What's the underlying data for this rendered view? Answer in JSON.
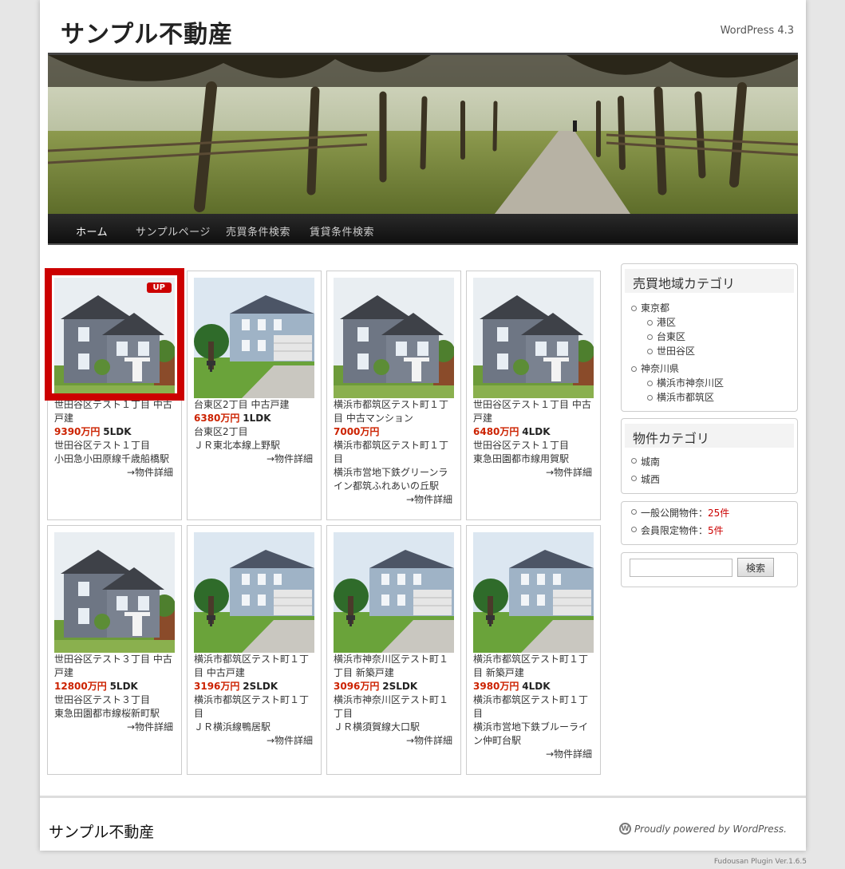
{
  "site": {
    "title": "サンプル不動産",
    "description": "WordPress 4.3"
  },
  "nav": {
    "items": [
      "ホーム",
      "サンプルページ",
      "売買条件検索",
      "賃貸条件検索"
    ]
  },
  "properties": [
    {
      "title": "世田谷区テスト１丁目 中古戸建",
      "price": "9390万円",
      "madori": "5LDK",
      "address": "世田谷区テスト１丁目",
      "station": "小田急小田原線千歳船橋駅",
      "detail": "→物件詳細",
      "badge": "UP",
      "image": "house-gray-icon"
    },
    {
      "title": "台東区2丁目 中古戸建",
      "price": "6380万円",
      "madori": "1LDK",
      "address": "台東区2丁目",
      "station": "ＪＲ東北本線上野駅",
      "detail": "→物件詳細",
      "image": "house-blue-icon"
    },
    {
      "title": "横浜市都筑区テスト町１丁目 中古マンション",
      "price": "7000万円",
      "madori": "",
      "address": "横浜市都筑区テスト町１丁目",
      "station": "横浜市営地下鉄グリーンライン都筑ふれあいの丘駅",
      "detail": "→物件詳細",
      "image": "house-gray-icon"
    },
    {
      "title": "世田谷区テスト１丁目 中古戸建",
      "price": "6480万円",
      "madori": "4LDK",
      "address": "世田谷区テスト１丁目",
      "station": "東急田園都市線用賀駅",
      "detail": "→物件詳細",
      "image": "house-gray-icon"
    },
    {
      "title": "世田谷区テスト３丁目 中古戸建",
      "price": "12800万円",
      "madori": "5LDK",
      "address": "世田谷区テスト３丁目",
      "station": "東急田園都市線桜新町駅",
      "detail": "→物件詳細",
      "image": "house-gray-icon"
    },
    {
      "title": "横浜市都筑区テスト町１丁目 中古戸建",
      "price": "3196万円",
      "madori": "2SLDK",
      "address": "横浜市都筑区テスト町１丁目",
      "station": "ＪＲ横浜線鴨居駅",
      "detail": "→物件詳細",
      "image": "house-blue-icon"
    },
    {
      "title": "横浜市神奈川区テスト町１丁目 新築戸建",
      "price": "3096万円",
      "madori": "2SLDK",
      "address": "横浜市神奈川区テスト町１丁目",
      "station": "ＪＲ横須賀線大口駅",
      "detail": "→物件詳細",
      "image": "house-blue-icon"
    },
    {
      "title": "横浜市都筑区テスト町１丁目 新築戸建",
      "price": "3980万円",
      "madori": "4LDK",
      "address": "横浜市都筑区テスト町１丁目",
      "station": "横浜市営地下鉄ブルーライン仲町台駅",
      "detail": "→物件詳細",
      "image": "house-blue-icon"
    }
  ],
  "sidebar": {
    "area_widget": {
      "title": "売買地域カテゴリ",
      "prefectures": [
        {
          "name": "東京都",
          "cities": [
            "港区",
            "台東区",
            "世田谷区"
          ]
        },
        {
          "name": "神奈川県",
          "cities": [
            "横浜市神奈川区",
            "横浜市都筑区"
          ]
        }
      ]
    },
    "category_widget": {
      "title": "物件カテゴリ",
      "items": [
        "城南",
        "城西"
      ]
    },
    "count_widget": {
      "public_label": "一般公開物件：",
      "public_count": "25件",
      "member_label": "会員限定物件：",
      "member_count": "5件"
    },
    "search_widget": {
      "value": "",
      "button_label": "検索"
    }
  },
  "footer": {
    "title": "サンプル不動産",
    "powered": "Proudly powered by WordPress.",
    "plugin_version": "Fudousan Plugin Ver.1.6.5"
  },
  "colors": {
    "price": "#cc2200",
    "highlight": "#cc0000",
    "nav_bg": "#111111"
  }
}
